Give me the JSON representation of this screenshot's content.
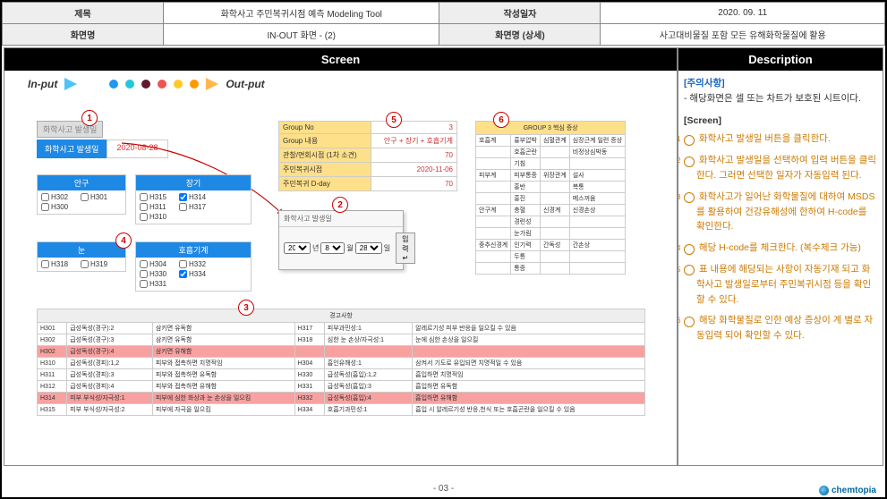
{
  "header": {
    "title_label": "제목",
    "title_value": "화학사고 주민복귀시점 예측 Modeling Tool",
    "date_label": "작성일자",
    "date_value": "2020. 09. 11",
    "screen_label": "화면명",
    "screen_value": "IN-OUT 화면 - (2)",
    "detail_label": "화면명 (상세)",
    "detail_value": "사고대비물질 포함 모든 유해화학물질에 활용"
  },
  "columns": {
    "screen": "Screen",
    "description": "Description"
  },
  "inout": {
    "input": "In-put",
    "output": "Out-put"
  },
  "badges": [
    "1",
    "2",
    "3",
    "4",
    "5",
    "6"
  ],
  "incident": {
    "btn": "화학사고 발생일",
    "label": "화학사고 발생일",
    "date": "2020-08-28"
  },
  "dialog": {
    "title": "화학사고 발생일",
    "year": "2020",
    "month": "8",
    "day": "28",
    "y_lbl": "년",
    "m_lbl": "월",
    "d_lbl": "일",
    "ok": "입력↵"
  },
  "groups": {
    "eye": {
      "title": "안구",
      "items": [
        {
          "code": "H302",
          "chk": false
        },
        {
          "code": "H301",
          "chk": false
        },
        {
          "code": "H300",
          "chk": false
        }
      ]
    },
    "liver": {
      "title": "장기",
      "items": [
        {
          "code": "H315",
          "chk": false
        },
        {
          "code": "H314",
          "chk": true
        },
        {
          "code": "H311",
          "chk": false
        },
        {
          "code": "H317",
          "chk": false
        },
        {
          "code": "H310",
          "chk": false
        }
      ]
    },
    "corr": {
      "title": "눈",
      "items": [
        {
          "code": "H318",
          "chk": false
        },
        {
          "code": "H319",
          "chk": false
        }
      ]
    },
    "resp": {
      "title": "호흡기계",
      "items": [
        {
          "code": "H304",
          "chk": false
        },
        {
          "code": "H332",
          "chk": false
        },
        {
          "code": "H330",
          "chk": false
        },
        {
          "code": "H334",
          "chk": true
        },
        {
          "code": "H331",
          "chk": false
        }
      ]
    }
  },
  "info": [
    {
      "k": "Group No",
      "v": "3"
    },
    {
      "k": "Group 내용",
      "v": "안구 + 장기 + 호흡기계"
    },
    {
      "k": "관찰/면회시점 (1차 소견)",
      "v": "70"
    },
    {
      "k": "주민복귀시점",
      "v": "2020-11-06"
    },
    {
      "k": "주민복귀 D-day",
      "v": "70"
    }
  ],
  "symptom": {
    "title": "GROUP 3 핵심 증상",
    "rows": [
      [
        "호흡계",
        "흉부압박",
        "심혈관계",
        "심장근계 일련 증상"
      ],
      [
        "",
        "호흡곤란",
        "",
        "비정상심박동"
      ],
      [
        "",
        "기침",
        "",
        ""
      ],
      [
        "피부계",
        "피부통증",
        "위장관계",
        "설사"
      ],
      [
        "",
        "홍반",
        "",
        "복통"
      ],
      [
        "",
        "홍진",
        "",
        "메스꺼움"
      ],
      [
        "안구계",
        "충혈",
        "신경계",
        "신경손상"
      ],
      [
        "",
        "경련성",
        "",
        ""
      ],
      [
        "",
        "눈가림",
        "",
        ""
      ],
      [
        "중추신경계",
        "인기력",
        "간독성",
        "간손상"
      ],
      [
        "",
        "두통",
        "",
        ""
      ],
      [
        "",
        "통증",
        "",
        ""
      ]
    ]
  },
  "warnings": {
    "title": "경고사항",
    "rows": [
      {
        "hl": false,
        "c": [
          "H301",
          "급성독성(경구):2",
          "삼키면 유독함",
          "H317",
          "피부과민성:1",
          "알레르기성 피부 반응을 일으킬 수 있음"
        ]
      },
      {
        "hl": false,
        "c": [
          "H302",
          "급성독성(경구):3",
          "삼키면 유독함",
          "H318",
          "심한 눈 손상/자극성:1",
          "눈에 심한 손상을 일으킬"
        ]
      },
      {
        "hl": true,
        "c": [
          "H302",
          "급성독성(경구):4",
          "삼키면 유해함",
          "",
          "",
          ""
        ]
      },
      {
        "hl": false,
        "c": [
          "H310",
          "급성독성(경피):1,2",
          "피부와 접촉하면 치명적임",
          "H304",
          "흡인유해성:1",
          "삼켜서 기도로 유입되면 치명적일 수 있음"
        ]
      },
      {
        "hl": false,
        "c": [
          "H311",
          "급성독성(경피):3",
          "피부와 접촉하면 유독함",
          "H330",
          "급성독성(흡입):1,2",
          "흡입하면 치명적임"
        ]
      },
      {
        "hl": false,
        "c": [
          "H312",
          "급성독성(경피):4",
          "피부와 접촉하면 유해함",
          "H331",
          "급성독성(흡입):3",
          "흡입하면 유독함"
        ]
      },
      {
        "hl": true,
        "c": [
          "H314",
          "피부 부식성/자극성:1",
          "피부에 심한 화상과 눈 손상을 일으킴",
          "H332",
          "급성독성(흡입):4",
          "흡입하면 유해함"
        ]
      },
      {
        "hl": false,
        "c": [
          "H315",
          "피부 부식성/자극성:2",
          "피부에 자극을 일으킴",
          "H334",
          "호흡기과민성:1",
          "흡입 시 알레르기성 반응,천식 또는 호흡곤란을 일으킬 수 있음"
        ]
      }
    ]
  },
  "desc": {
    "caution_h": "[주의사항]",
    "caution_t": "- 해당화면은 셀 또는 차트가 보호된 시트이다.",
    "screen_h": "[Screen]",
    "items": [
      "화학사고 발생일 버튼을 클릭한다.",
      "화학사고 발생일을 선택하여 입력 버튼을 클릭한다. 그러면 선택한 일자가 자동입력 된다.",
      "화학사고가 일어난 화학물질에 대하여 MSDS를 활용하여 건강유해성에 한하여 H-code를 확인한다.",
      "해당 H-code를 체크한다. (복수체크 가능)",
      "표 내용에 해당되는 사항이 자동기재 되고 화학사고 발생일로부터 주민복귀시점 등을 확인할 수 있다.",
      "해당 화학물질로 인한 예상 증상이 계 별로 자동입력 되어 확인할 수 있다."
    ]
  },
  "footer": {
    "page": "- 03 -",
    "brand": "chemtopia"
  }
}
